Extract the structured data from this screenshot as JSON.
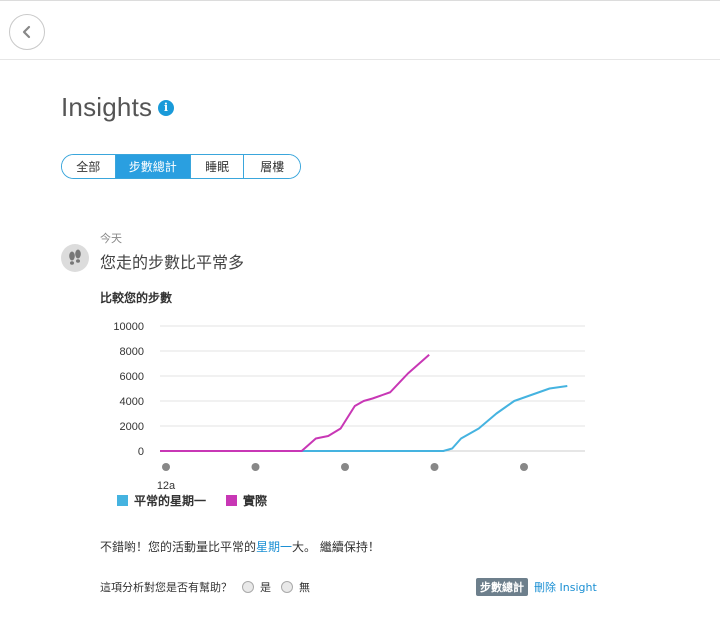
{
  "header": {
    "back_icon": "chevron-left-icon"
  },
  "page": {
    "title": "Insights",
    "info_glyph": "i"
  },
  "tabs": [
    {
      "label": "全部",
      "active": false
    },
    {
      "label": "步數總計",
      "active": true
    },
    {
      "label": "睡眠",
      "active": false
    },
    {
      "label": "層樓",
      "active": false
    }
  ],
  "insight": {
    "icon": "footprints-icon",
    "date": "今天",
    "headline": "您走的步數比平常多",
    "chart_title": "比較您的步數",
    "message_before": "不錯喲！您的活動量比平常的",
    "message_link": "星期一",
    "message_after": "大。 繼續保持！"
  },
  "chart_data": {
    "type": "line",
    "title": "比較您的步數",
    "y_ticks": [
      "10000",
      "8000",
      "6000",
      "4000",
      "2000",
      "0"
    ],
    "ylim": [
      0,
      10000
    ],
    "x_tick_label": "12a",
    "x_dot_count": 5,
    "xlim": [
      0,
      24
    ],
    "grid": true,
    "legend_position": "bottom-left",
    "series": [
      {
        "name": "平常的星期一",
        "color": "#45b3e0",
        "x": [
          0,
          2,
          4,
          6,
          8,
          10,
          12,
          14,
          15.5,
          16,
          16.5,
          17,
          18,
          19,
          19.5,
          20,
          21,
          22,
          23
        ],
        "y": [
          0,
          0,
          0,
          0,
          0,
          0,
          0,
          0,
          0,
          0,
          200,
          1000,
          1800,
          3000,
          3500,
          4000,
          4500,
          5000,
          5200
        ]
      },
      {
        "name": "實際",
        "color": "#c837b5",
        "x": [
          0,
          2,
          4,
          6,
          8,
          8.8,
          9.5,
          10.2,
          11,
          11.5,
          12,
          13,
          14,
          15.2
        ],
        "y": [
          0,
          0,
          0,
          0,
          0,
          1000,
          1200,
          1800,
          3600,
          4000,
          4200,
          4700,
          6200,
          7700
        ]
      }
    ]
  },
  "feedback": {
    "question": "這項分析對您是否有幫助？",
    "yes": "是",
    "no": "無"
  },
  "footer": {
    "category": "步數總計",
    "delete": "刪除 Insight"
  }
}
